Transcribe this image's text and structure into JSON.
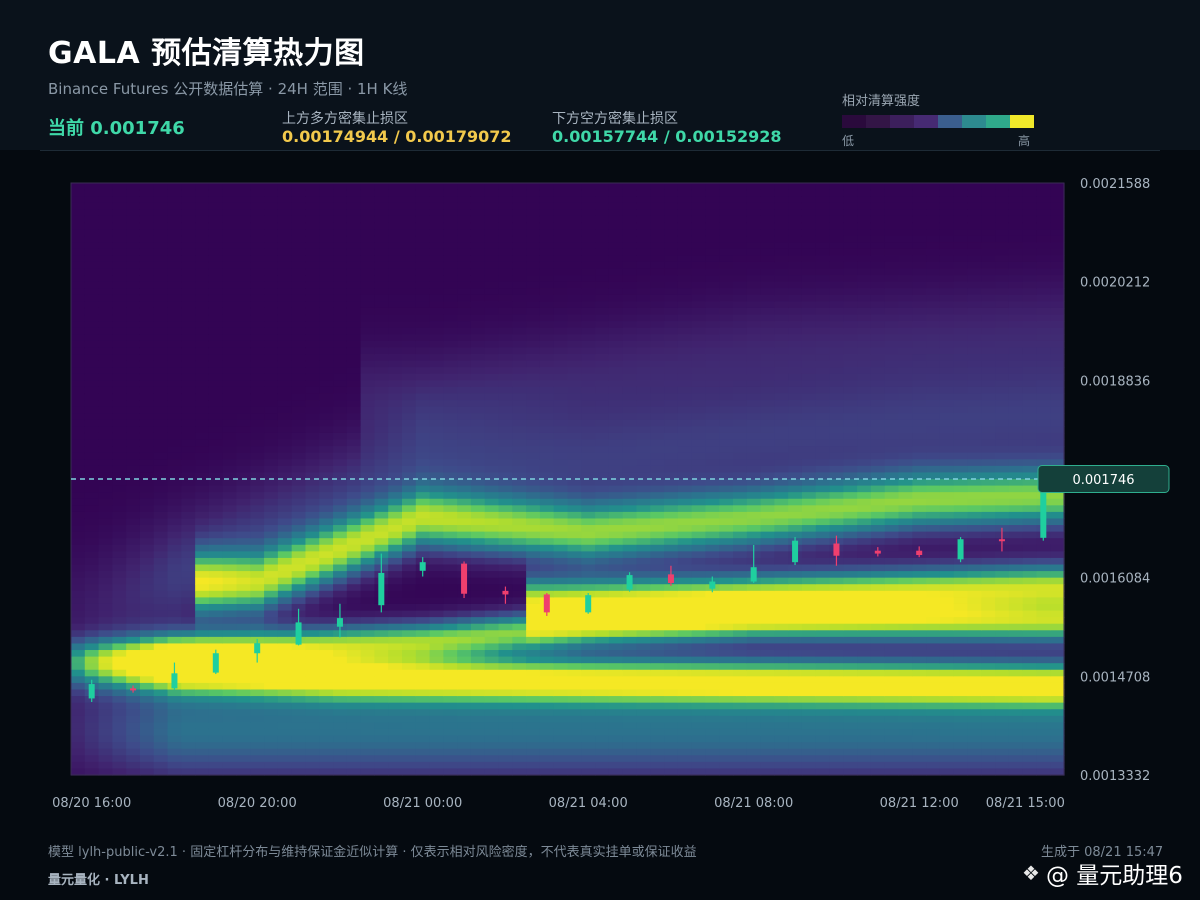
{
  "header": {
    "title": "GALA 预估清算热力图",
    "subtitle": "Binance Futures 公开数据估算 · 24H 范围 · 1H K线",
    "current_label": "当前 0.001746",
    "upper_zone_label": "上方多方密集止损区",
    "upper_zone_value": "0.00174944 / 0.00179072",
    "lower_zone_label": "下方空方密集止损区",
    "lower_zone_value": "0.00157744 / 0.00152928"
  },
  "scale": {
    "title": "相对清算强度",
    "low_label": "低",
    "high_label": "高",
    "colors": [
      "#2a0a3c",
      "#331546",
      "#3c1f5c",
      "#462a73",
      "#3b5e8e",
      "#2d8a8f",
      "#2fa98a",
      "#f0e82a"
    ]
  },
  "price_tag": "0.001746",
  "footer": {
    "note": "模型 lylh-public-v2.1 · 固定杠杆分布与维持保证金近似计算 · 仅表示相对风险密度，不代表真实挂单或保证收益",
    "generated": "生成于 08/21 15:47",
    "brand": "量元量化 · LYLH"
  },
  "watermark": "@ 量元助理6",
  "colors": {
    "up": "#1fcf9f",
    "down": "#ef3f6e",
    "price_line": "#7fd3e0"
  },
  "chart_data": {
    "type": "heatmap",
    "title": "GALA 预估清算热力图",
    "y_ticks": [
      "0.0021588",
      "0.0020212",
      "0.0018836",
      "0.0017460",
      "0.0016084",
      "0.0014708",
      "0.0013332"
    ],
    "y_tick_labels": [
      "0.0021588",
      "0.0020212",
      "0.0018836",
      "",
      "0.0016084",
      "0.0014708",
      "0.0013332"
    ],
    "ylim": [
      0.0013332,
      0.0021588
    ],
    "x_ticks": [
      "08/20 16:00",
      "08/20 20:00",
      "08/21 00:00",
      "08/21 04:00",
      "08/21 08:00",
      "08/21 12:00",
      "08/21 15:00"
    ],
    "x_tick_hours": [
      0,
      4,
      8,
      12,
      16,
      20,
      23
    ],
    "xlim_hours": [
      -0.5,
      23.5
    ],
    "current_price": 0.001746,
    "candles": [
      {
        "t": 0,
        "o": 0.00144,
        "h": 0.001466,
        "l": 0.001435,
        "c": 0.00146
      },
      {
        "t": 1,
        "o": 0.001454,
        "h": 0.001458,
        "l": 0.001448,
        "c": 0.001452
      },
      {
        "t": 2,
        "o": 0.001454,
        "h": 0.00149,
        "l": 0.001452,
        "c": 0.001475
      },
      {
        "t": 3,
        "o": 0.001476,
        "h": 0.001508,
        "l": 0.001474,
        "c": 0.001503
      },
      {
        "t": 4,
        "o": 0.001503,
        "h": 0.001523,
        "l": 0.00149,
        "c": 0.001517
      },
      {
        "t": 5,
        "o": 0.001515,
        "h": 0.001565,
        "l": 0.001514,
        "c": 0.001546
      },
      {
        "t": 6,
        "o": 0.00154,
        "h": 0.001572,
        "l": 0.001525,
        "c": 0.001552
      },
      {
        "t": 7,
        "o": 0.00157,
        "h": 0.001642,
        "l": 0.00156,
        "c": 0.001615
      },
      {
        "t": 8,
        "o": 0.001618,
        "h": 0.001637,
        "l": 0.00161,
        "c": 0.00163
      },
      {
        "t": 9,
        "o": 0.001628,
        "h": 0.001631,
        "l": 0.00158,
        "c": 0.001586
      },
      {
        "t": 10,
        "o": 0.00159,
        "h": 0.001596,
        "l": 0.001572,
        "c": 0.001585
      },
      {
        "t": 11,
        "o": 0.001585,
        "h": 0.001587,
        "l": 0.001555,
        "c": 0.00156
      },
      {
        "t": 12,
        "o": 0.00156,
        "h": 0.001587,
        "l": 0.001558,
        "c": 0.001584
      },
      {
        "t": 13,
        "o": 0.001592,
        "h": 0.001616,
        "l": 0.001589,
        "c": 0.001612
      },
      {
        "t": 14,
        "o": 0.001613,
        "h": 0.001625,
        "l": 0.001597,
        "c": 0.001601
      },
      {
        "t": 15,
        "o": 0.001593,
        "h": 0.00161,
        "l": 0.001588,
        "c": 0.001603
      },
      {
        "t": 16,
        "o": 0.001603,
        "h": 0.001654,
        "l": 0.001601,
        "c": 0.001623
      },
      {
        "t": 17,
        "o": 0.00163,
        "h": 0.001665,
        "l": 0.001626,
        "c": 0.00166
      },
      {
        "t": 18,
        "o": 0.001656,
        "h": 0.001667,
        "l": 0.001625,
        "c": 0.001639
      },
      {
        "t": 19,
        "o": 0.001646,
        "h": 0.001651,
        "l": 0.001638,
        "c": 0.001642
      },
      {
        "t": 20,
        "o": 0.001646,
        "h": 0.001652,
        "l": 0.001637,
        "c": 0.00164
      },
      {
        "t": 21,
        "o": 0.001634,
        "h": 0.001665,
        "l": 0.00163,
        "c": 0.001662
      },
      {
        "t": 22,
        "o": 0.001662,
        "h": 0.001678,
        "l": 0.001645,
        "c": 0.001661
      },
      {
        "t": 23,
        "o": 0.001664,
        "h": 0.001746,
        "l": 0.00166,
        "c": 0.001746
      }
    ],
    "bands": [
      {
        "name": "lower-dense",
        "points": [
          [
            0,
            0.00148
          ],
          [
            6,
            0.001468
          ],
          [
            12,
            0.001465
          ],
          [
            23,
            0.00146
          ]
        ],
        "sigma": 2.2e-05,
        "strength": 0.95
      },
      {
        "name": "lower-mid",
        "points": [
          [
            0,
            0.0015
          ],
          [
            8,
            0.00152
          ],
          [
            12,
            0.00154
          ],
          [
            16,
            0.001548
          ],
          [
            23,
            0.001545
          ]
        ],
        "sigma": 2e-05,
        "strength": 0.8
      },
      {
        "name": "mid",
        "points": [
          [
            12,
            0.001575
          ],
          [
            16,
            0.001582
          ],
          [
            20,
            0.00159
          ],
          [
            23,
            0.001595
          ]
        ],
        "sigma": 2.4e-05,
        "strength": 0.9
      },
      {
        "name": "upper-dense",
        "points": [
          [
            4,
            0.0016
          ],
          [
            8,
            0.00169
          ],
          [
            12,
            0.00167
          ],
          [
            16,
            0.00169
          ],
          [
            20,
            0.001715
          ],
          [
            23,
            0.00172
          ]
        ],
        "sigma": 3e-05,
        "strength": 0.78
      },
      {
        "name": "upper-faint",
        "points": [
          [
            0,
            0.00156
          ],
          [
            8,
            0.00176
          ],
          [
            12,
            0.00177
          ],
          [
            16,
            0.0018
          ],
          [
            20,
            0.00182
          ],
          [
            23,
            0.00183
          ]
        ],
        "sigma": 6e-05,
        "strength": 0.25
      },
      {
        "name": "top-faint",
        "points": [
          [
            8,
            0.00186
          ],
          [
            16,
            0.00193
          ],
          [
            23,
            0.001955
          ]
        ],
        "sigma": 5e-05,
        "strength": 0.14
      },
      {
        "name": "bottom-floor",
        "points": [
          [
            0,
            0.001395
          ],
          [
            12,
            0.001395
          ],
          [
            23,
            0.001395
          ]
        ],
        "sigma": 5e-05,
        "strength": 0.45
      }
    ]
  }
}
